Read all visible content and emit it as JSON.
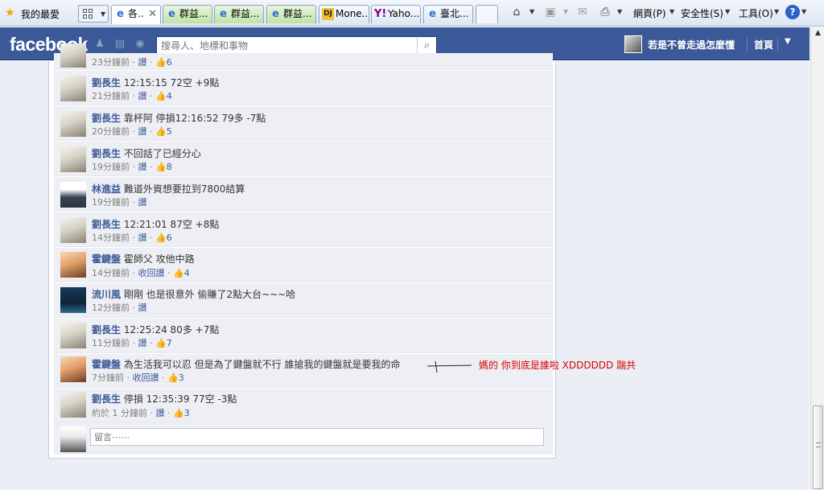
{
  "ie": {
    "favorites_label": "我的最愛",
    "tabs": [
      {
        "label": "各..",
        "active": true
      },
      {
        "label": "群益..."
      },
      {
        "label": "群益..."
      },
      {
        "label": "群益..."
      },
      {
        "label": "Mone..."
      },
      {
        "label": "Yaho..."
      },
      {
        "label": "臺北..."
      }
    ],
    "commands": {
      "page": "網頁(P)",
      "safety": "安全性(S)",
      "tools": "工具(O)"
    },
    "icons": [
      "home-icon",
      "rss-icon",
      "mail-icon",
      "print-icon",
      "help-icon"
    ]
  },
  "fb": {
    "logo": "facebook",
    "search_placeholder": "搜尋人、地標和事物",
    "user_name": "若是不曾走過怎麼懂",
    "home": "首頁",
    "brand_color": "#3b5998"
  },
  "comments": [
    {
      "author": "",
      "text": "",
      "time": "23分鐘前",
      "like": "讚",
      "count": "6"
    },
    {
      "author": "劉長生",
      "text": "12:15:15 72空 +9點",
      "time": "21分鐘前",
      "like": "讚",
      "count": "4"
    },
    {
      "author": "劉長生",
      "text": "靠杯阿 停損12:16:52 79多 -7點",
      "time": "20分鐘前",
      "like": "讚",
      "count": "5"
    },
    {
      "author": "劉長生",
      "text": "不回話了已經分心",
      "time": "19分鐘前",
      "like": "讚",
      "count": "8"
    },
    {
      "author": "林進益",
      "text": "難道外資想要拉到7800結算",
      "time": "19分鐘前",
      "like": "讚",
      "count": ""
    },
    {
      "author": "劉長生",
      "text": "12:21:01 87空 +8點",
      "time": "14分鐘前",
      "like": "讚",
      "count": "6"
    },
    {
      "author": "霍鍵盤",
      "text": "霍師父 攻他中路",
      "time": "14分鐘前",
      "like": "收回讚",
      "count": "4"
    },
    {
      "author": "流川風",
      "text": "剛剛 也是很意外 偷賺了2點大台~~~哈",
      "time": "12分鐘前",
      "like": "讚",
      "count": ""
    },
    {
      "author": "劉長生",
      "text": "12:25:24 80多 +7點",
      "time": "11分鐘前",
      "like": "讚",
      "count": "7"
    },
    {
      "author": "霍鍵盤",
      "text": "為生活我可以忍 但是為了鍵盤就不行 誰搶我的鍵盤就是要我的命",
      "time": "7分鐘前",
      "like": "收回讚",
      "count": "3"
    },
    {
      "author": "劉長生",
      "text": "停損 12:35:39 77空 -3點",
      "time": "約於 1 分鐘前",
      "like": "讚",
      "count": "3"
    }
  ],
  "reply_placeholder": "留言⋯⋯",
  "annotation": "媽的 你到底是誰啦 XDDDDDD 踹共"
}
